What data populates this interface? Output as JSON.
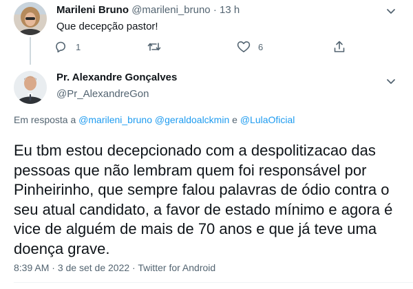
{
  "parent_tweet": {
    "author_name": "Marileni Bruno",
    "handle": "@marileni_bruno",
    "separator": "·",
    "time": "13 h",
    "text": "Que decepção pastor!",
    "reply_count": "1",
    "like_count": "6"
  },
  "main_tweet": {
    "author_name": "Pr. Alexandre Gonçalves",
    "handle": "@Pr_AlexandreGon",
    "reply_prefix": "Em resposta a",
    "mentions": [
      "@marileni_bruno",
      "@geraldoalckmin"
    ],
    "mention_joiner": "e",
    "last_mention": "@LulaOficial",
    "text": "Eu tbm estou decepcionado com a despolitizacao das pessoas que não lembram quem foi responsável por Pinheirinho, que sempre falou palavras de ódio contra o seu atual candidato, a favor de estado mínimo e agora é vice de alguém de mais de 70 anos e que já teve uma doença grave.",
    "time": "8:39 AM",
    "date": "3 de set de 2022",
    "source": "Twitter for Android",
    "meta_separator": "·"
  },
  "colors": {
    "text": "#0f1419",
    "secondary": "#536471",
    "link": "#1d9bf0",
    "thread_line": "#cfd9de"
  }
}
